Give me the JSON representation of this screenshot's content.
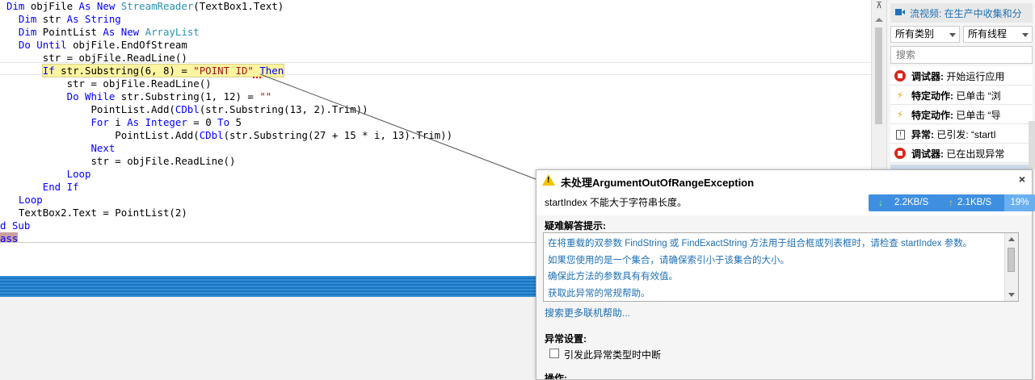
{
  "code": {
    "lines": [
      {
        "pre": "",
        "segs": [
          {
            "t": "Dim",
            "c": "kw"
          },
          {
            "t": " objFile ",
            "c": ""
          },
          {
            "t": "As New",
            "c": "kw"
          },
          {
            "t": " ",
            "c": ""
          },
          {
            "t": "StreamReader",
            "c": "ty"
          },
          {
            "t": "(TextBox1.Text)",
            "c": ""
          }
        ]
      },
      {
        "pre": "  ",
        "segs": [
          {
            "t": "Dim",
            "c": "kw"
          },
          {
            "t": " str ",
            "c": ""
          },
          {
            "t": "As String",
            "c": "kw"
          }
        ]
      },
      {
        "pre": "  ",
        "segs": [
          {
            "t": "Dim",
            "c": "kw"
          },
          {
            "t": " PointList ",
            "c": ""
          },
          {
            "t": "As New",
            "c": "kw"
          },
          {
            "t": " ",
            "c": ""
          },
          {
            "t": "ArrayList",
            "c": "ty"
          }
        ]
      },
      {
        "pre": "  ",
        "segs": [
          {
            "t": "Do Until",
            "c": "kw"
          },
          {
            "t": " objFile.EndOfStream",
            "c": ""
          }
        ]
      },
      {
        "pre": "      ",
        "segs": [
          {
            "t": "str = objFile.ReadLine()",
            "c": ""
          }
        ]
      },
      {
        "pre": "      ",
        "hl": true,
        "segs": [
          {
            "t": "If",
            "c": "kw"
          },
          {
            "t": " str.Substring(6, 8) = ",
            "c": ""
          },
          {
            "t": "\"POINT ID\"",
            "c": "str"
          },
          {
            "t": " ",
            "c": ""
          },
          {
            "t": "Then",
            "c": "kw"
          }
        ]
      },
      {
        "pre": "          ",
        "segs": [
          {
            "t": "str = objFile.ReadLine()",
            "c": ""
          }
        ]
      },
      {
        "pre": "          ",
        "segs": [
          {
            "t": "Do While",
            "c": "kw"
          },
          {
            "t": " str.Substring(1, 12) = ",
            "c": ""
          },
          {
            "t": "\"\"",
            "c": "str"
          }
        ]
      },
      {
        "pre": "              ",
        "segs": [
          {
            "t": "PointList.Add(",
            "c": ""
          },
          {
            "t": "CDbl",
            "c": "kw"
          },
          {
            "t": "(str.Substring(13, 2).Trim))",
            "c": ""
          }
        ]
      },
      {
        "pre": "              ",
        "segs": [
          {
            "t": "For",
            "c": "kw"
          },
          {
            "t": " i ",
            "c": ""
          },
          {
            "t": "As Integer",
            "c": "kw"
          },
          {
            "t": " = 0 ",
            "c": ""
          },
          {
            "t": "To",
            "c": "kw"
          },
          {
            "t": " 5",
            "c": ""
          }
        ]
      },
      {
        "pre": "                  ",
        "segs": [
          {
            "t": "PointList.Add(",
            "c": ""
          },
          {
            "t": "CDbl",
            "c": "kw"
          },
          {
            "t": "(str.Substring(27 + 15 * i, 13).Trim))",
            "c": ""
          }
        ]
      },
      {
        "pre": "              ",
        "segs": [
          {
            "t": "Next",
            "c": "kw"
          }
        ]
      },
      {
        "pre": "              ",
        "segs": [
          {
            "t": "str = objFile.ReadLine()",
            "c": ""
          }
        ]
      },
      {
        "pre": "          ",
        "segs": [
          {
            "t": "Loop",
            "c": "kw"
          }
        ]
      },
      {
        "pre": "      ",
        "segs": [
          {
            "t": "End If",
            "c": "kw"
          }
        ]
      },
      {
        "pre": "  ",
        "segs": [
          {
            "t": "Loop",
            "c": "kw"
          }
        ]
      },
      {
        "pre": "  ",
        "segs": [
          {
            "t": "TextBox2.Text = PointList(2)",
            "c": ""
          }
        ]
      },
      {
        "pre": "",
        "segs": [
          {
            "t": "d Sub",
            "c": "kw"
          }
        ]
      },
      {
        "pre": "",
        "segs": [
          {
            "t": "ass",
            "c": "kw"
          }
        ]
      }
    ]
  },
  "diagnostics": {
    "header": "流视频: 在生产中收集和分",
    "category_filter": "所有类别",
    "thread_filter": "所有线程",
    "search_placeholder": "搜索",
    "events": [
      {
        "icon": "stop",
        "label": "调试器:",
        "desc": " 开始运行应用"
      },
      {
        "icon": "bolt",
        "label": "特定动作:",
        "desc": " 已单击 “浏"
      },
      {
        "icon": "bolt",
        "label": "特定动作:",
        "desc": " 已单击 “导"
      },
      {
        "icon": "exception",
        "label": "异常:",
        "desc": " 已引发: “startI"
      },
      {
        "icon": "stop",
        "label": "调试器:",
        "desc": " 已在出现异常"
      }
    ]
  },
  "exception": {
    "title": "未处理ArgumentOutOfRangeException",
    "close_glyph": "×",
    "message": "startIndex 不能大于字符串长度。",
    "tips_label": "疑难解答提示:",
    "tips": [
      "在将重载的双参数 FindString 或 FindExactString 方法用于组合框或列表框时，请检查 startIndex 参数。",
      "如果您使用的是一个集合，请确保索引小于该集合的大小。",
      "确保此方法的参数具有有效值。",
      "获取此异常的常规帮助。"
    ],
    "more_help": "搜索更多联机帮助...",
    "settings_label": "异常设置:",
    "checkbox_label": "引发此异常类型时中断",
    "actions_label": "操作:"
  },
  "network": {
    "down_glyph": "↓",
    "up_glyph": "↑",
    "download": "2.2KB/S",
    "upload": "2.1KB/S",
    "percent": "19%"
  },
  "scroll_split_glyph": "⊼"
}
